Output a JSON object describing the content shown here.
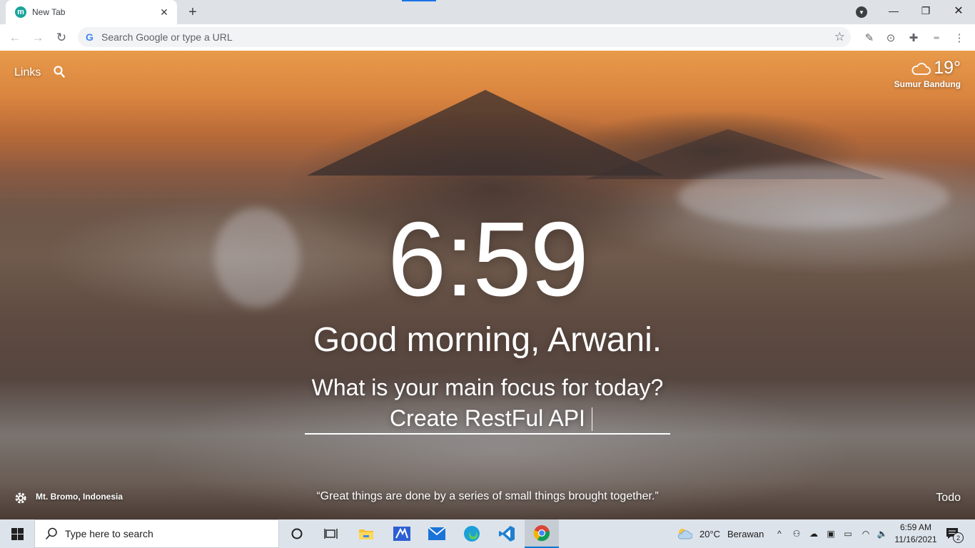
{
  "browser": {
    "tab": {
      "favicon_letter": "m",
      "title": "New Tab"
    },
    "omnibox": {
      "placeholder": "Search Google or type a URL"
    }
  },
  "momentum": {
    "links_label": "Links",
    "weather": {
      "temp": "19°",
      "location": "Sumur Bandung"
    },
    "clock": "6:59",
    "greeting": "Good morning, Arwani.",
    "focus_question": "What is your main focus for today?",
    "focus_value": "Create RestFul API",
    "photo_location": "Mt. Bromo, Indonesia",
    "quote": "“Great things are done by a series of small things brought together.”",
    "todo_label": "Todo"
  },
  "taskbar": {
    "search_placeholder": "Type here to search",
    "weather": {
      "temp": "20°C",
      "condition": "Berawan"
    },
    "time": "6:59 AM",
    "date": "11/16/2021",
    "notification_count": "2"
  },
  "colors": {
    "accent": "#1a73e8",
    "taskbar_bg": "#dde3ea",
    "momentum_favicon": "#1ba39c"
  }
}
